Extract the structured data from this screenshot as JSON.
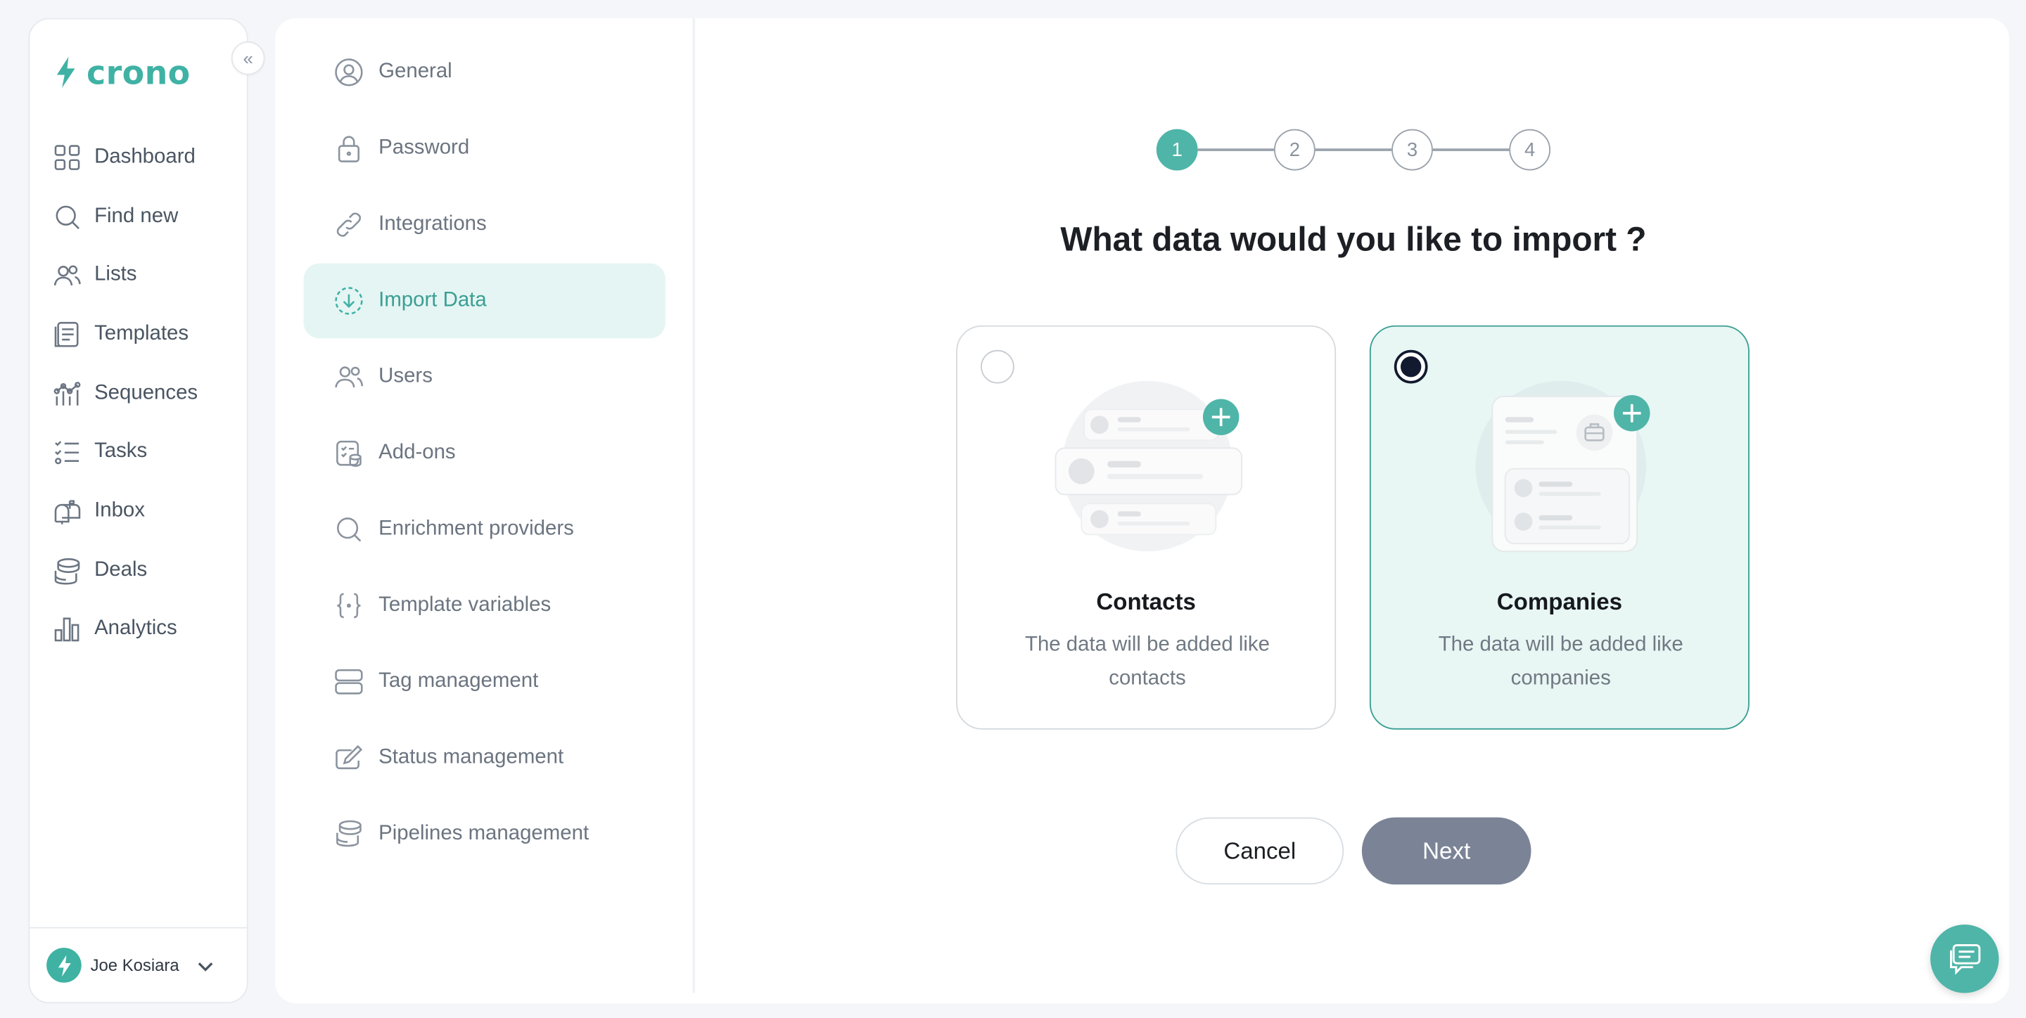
{
  "brand": {
    "name": "crono",
    "color": "#3fb2a4"
  },
  "sidebar": {
    "items": [
      {
        "label": "Dashboard",
        "icon": "grid-icon"
      },
      {
        "label": "Find new",
        "icon": "search-icon"
      },
      {
        "label": "Lists",
        "icon": "users-icon"
      },
      {
        "label": "Templates",
        "icon": "template-icon"
      },
      {
        "label": "Sequences",
        "icon": "sequence-icon"
      },
      {
        "label": "Tasks",
        "icon": "tasks-icon"
      },
      {
        "label": "Inbox",
        "icon": "mailbox-icon"
      },
      {
        "label": "Deals",
        "icon": "coins-icon"
      },
      {
        "label": "Analytics",
        "icon": "bar-chart-icon"
      }
    ],
    "user": {
      "name": "Joe Kosiara"
    }
  },
  "settings_nav": {
    "items": [
      {
        "label": "General",
        "icon": "user-circle-icon"
      },
      {
        "label": "Password",
        "icon": "lock-icon"
      },
      {
        "label": "Integrations",
        "icon": "link-icon"
      },
      {
        "label": "Import Data",
        "icon": "download-circle-icon",
        "active": true
      },
      {
        "label": "Users",
        "icon": "users-icon"
      },
      {
        "label": "Add-ons",
        "icon": "addons-icon"
      },
      {
        "label": "Enrichment providers",
        "icon": "search-icon"
      },
      {
        "label": "Template variables",
        "icon": "braces-icon"
      },
      {
        "label": "Tag management",
        "icon": "tag-stack-icon"
      },
      {
        "label": "Status management",
        "icon": "status-pen-icon"
      },
      {
        "label": "Pipelines management",
        "icon": "pipeline-coins-icon"
      }
    ]
  },
  "wizard": {
    "steps": [
      "1",
      "2",
      "3",
      "4"
    ],
    "current_step": 1,
    "question": "What data would you like to import ?",
    "options": [
      {
        "title": "Contacts",
        "description": "The data will be added like contacts",
        "selected": false
      },
      {
        "title": "Companies",
        "description": "The data will be added like companies",
        "selected": true
      }
    ],
    "cancel_label": "Cancel",
    "next_label": "Next"
  },
  "colors": {
    "accent": "#3fb2a4",
    "next_button": "#7b8496",
    "active_bg": "#e5f5f3"
  }
}
